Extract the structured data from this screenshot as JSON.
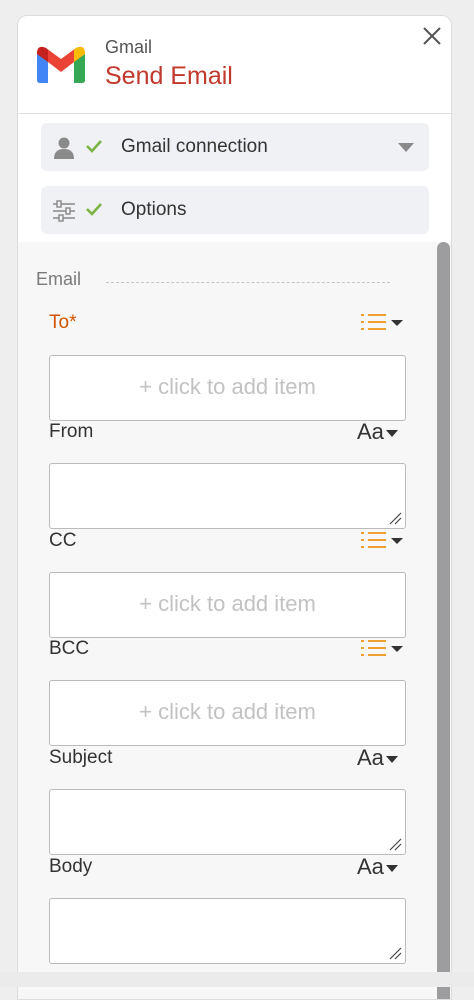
{
  "header": {
    "app_name": "Gmail",
    "action_title": "Send Email",
    "brand_colors": {
      "red": "#EA4335",
      "blue": "#4285F4",
      "green": "#34A853",
      "yellow": "#FBBC04",
      "title_red": "#c0392b"
    }
  },
  "sections": {
    "connection": {
      "label": "Gmail connection",
      "icon": "user-icon",
      "status_icon": "checkmark-icon",
      "expand_icon": "caret-down-icon"
    },
    "options": {
      "label": "Options",
      "icon": "sliders-icon",
      "status_icon": "checkmark-icon"
    }
  },
  "form": {
    "group_label": "Email",
    "fields": {
      "to": {
        "label": "To*",
        "type_icon": "list-icon",
        "placeholder": "+ click to add item"
      },
      "from": {
        "label": "From",
        "type_label": "Aa",
        "value": ""
      },
      "cc": {
        "label": "CC",
        "type_icon": "list-icon",
        "placeholder": "+ click to add item"
      },
      "bcc": {
        "label": "BCC",
        "type_icon": "list-icon",
        "placeholder": "+ click to add item"
      },
      "subject": {
        "label": "Subject",
        "type_label": "Aa",
        "value": ""
      },
      "body": {
        "label": "Body",
        "type_label": "Aa",
        "value": ""
      }
    }
  },
  "colors": {
    "required": "#d35400",
    "list_icon": "#f0a030",
    "check": "#7cb342"
  }
}
